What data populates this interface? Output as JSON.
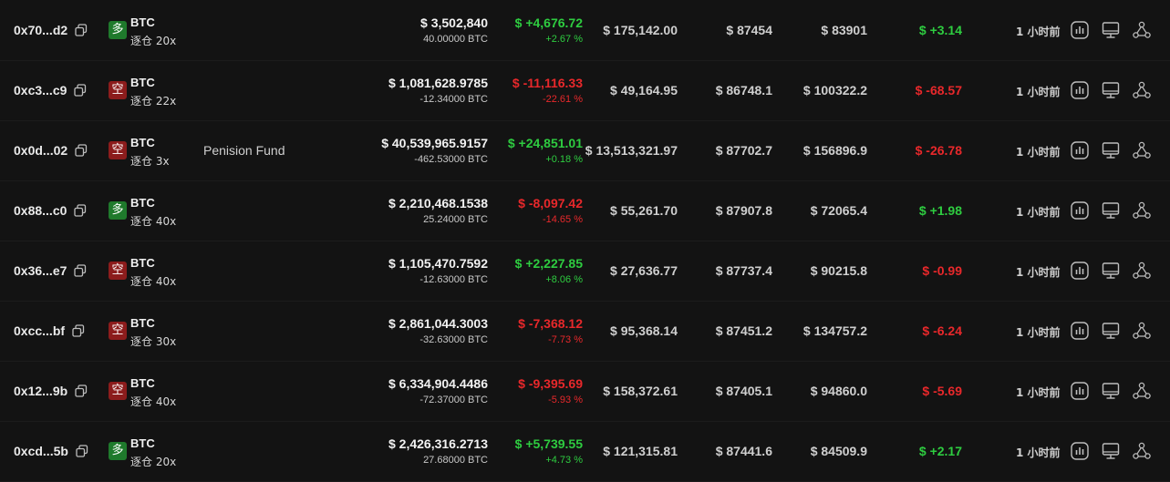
{
  "rows": [
    {
      "address": "0x70...d2",
      "side": "long",
      "side_label": "多",
      "asset": "BTC",
      "margin_mode": "逐仓 20x",
      "label": "",
      "value": "$ 3,502,840",
      "size": "40.00000 BTC",
      "pnl": "$ +4,676.72",
      "pnl_pct": "+2.67 %",
      "pnl_dir": "pos",
      "margin": "$ 175,142.00",
      "entry": "$ 87454",
      "liq": "$ 83901",
      "funding": "$ +3.14",
      "funding_dir": "pos",
      "time": "1 小时前"
    },
    {
      "address": "0xc3...c9",
      "side": "short",
      "side_label": "空",
      "asset": "BTC",
      "margin_mode": "逐仓 22x",
      "label": "",
      "value": "$ 1,081,628.9785",
      "size": "-12.34000 BTC",
      "pnl": "$ -11,116.33",
      "pnl_pct": "-22.61 %",
      "pnl_dir": "neg",
      "margin": "$ 49,164.95",
      "entry": "$ 86748.1",
      "liq": "$ 100322.2",
      "funding": "$ -68.57",
      "funding_dir": "neg",
      "time": "1 小时前"
    },
    {
      "address": "0x0d...02",
      "side": "short",
      "side_label": "空",
      "asset": "BTC",
      "margin_mode": "逐仓 3x",
      "label": "Penision Fund",
      "value": "$ 40,539,965.9157",
      "size": "-462.53000 BTC",
      "pnl": "$ +24,851.01",
      "pnl_pct": "+0.18 %",
      "pnl_dir": "pos",
      "margin": "$ 13,513,321.97",
      "entry": "$ 87702.7",
      "liq": "$ 156896.9",
      "funding": "$ -26.78",
      "funding_dir": "neg",
      "time": "1 小时前"
    },
    {
      "address": "0x88...c0",
      "side": "long",
      "side_label": "多",
      "asset": "BTC",
      "margin_mode": "逐仓 40x",
      "label": "",
      "value": "$ 2,210,468.1538",
      "size": "25.24000 BTC",
      "pnl": "$ -8,097.42",
      "pnl_pct": "-14.65 %",
      "pnl_dir": "neg",
      "margin": "$ 55,261.70",
      "entry": "$ 87907.8",
      "liq": "$ 72065.4",
      "funding": "$ +1.98",
      "funding_dir": "pos",
      "time": "1 小时前"
    },
    {
      "address": "0x36...e7",
      "side": "short",
      "side_label": "空",
      "asset": "BTC",
      "margin_mode": "逐仓 40x",
      "label": "",
      "value": "$ 1,105,470.7592",
      "size": "-12.63000 BTC",
      "pnl": "$ +2,227.85",
      "pnl_pct": "+8.06 %",
      "pnl_dir": "pos",
      "margin": "$ 27,636.77",
      "entry": "$ 87737.4",
      "liq": "$ 90215.8",
      "funding": "$ -0.99",
      "funding_dir": "neg",
      "time": "1 小时前"
    },
    {
      "address": "0xcc...bf",
      "side": "short",
      "side_label": "空",
      "asset": "BTC",
      "margin_mode": "逐仓 30x",
      "label": "",
      "value": "$ 2,861,044.3003",
      "size": "-32.63000 BTC",
      "pnl": "$ -7,368.12",
      "pnl_pct": "-7.73 %",
      "pnl_dir": "neg",
      "margin": "$ 95,368.14",
      "entry": "$ 87451.2",
      "liq": "$ 134757.2",
      "funding": "$ -6.24",
      "funding_dir": "neg",
      "time": "1 小时前"
    },
    {
      "address": "0x12...9b",
      "side": "short",
      "side_label": "空",
      "asset": "BTC",
      "margin_mode": "逐仓 40x",
      "label": "",
      "value": "$ 6,334,904.4486",
      "size": "-72.37000 BTC",
      "pnl": "$ -9,395.69",
      "pnl_pct": "-5.93 %",
      "pnl_dir": "neg",
      "margin": "$ 158,372.61",
      "entry": "$ 87405.1",
      "liq": "$ 94860.0",
      "funding": "$ -5.69",
      "funding_dir": "neg",
      "time": "1 小时前"
    },
    {
      "address": "0xcd...5b",
      "side": "long",
      "side_label": "多",
      "asset": "BTC",
      "margin_mode": "逐仓 20x",
      "label": "",
      "value": "$ 2,426,316.2713",
      "size": "27.68000 BTC",
      "pnl": "$ +5,739.55",
      "pnl_pct": "+4.73 %",
      "pnl_dir": "pos",
      "margin": "$ 121,315.81",
      "entry": "$ 87441.6",
      "liq": "$ 84509.9",
      "funding": "$ +2.17",
      "funding_dir": "pos",
      "time": "1 小时前"
    }
  ],
  "icons": {
    "copy": "copy-icon",
    "chart": "chart-icon",
    "monitor": "monitor-icon",
    "share": "share-nodes-icon"
  },
  "colors": {
    "positive": "#2ecc40",
    "negative": "#e8282b",
    "long_badge": "#1f7a2c",
    "short_badge": "#8c1c1c",
    "background": "#131313"
  }
}
